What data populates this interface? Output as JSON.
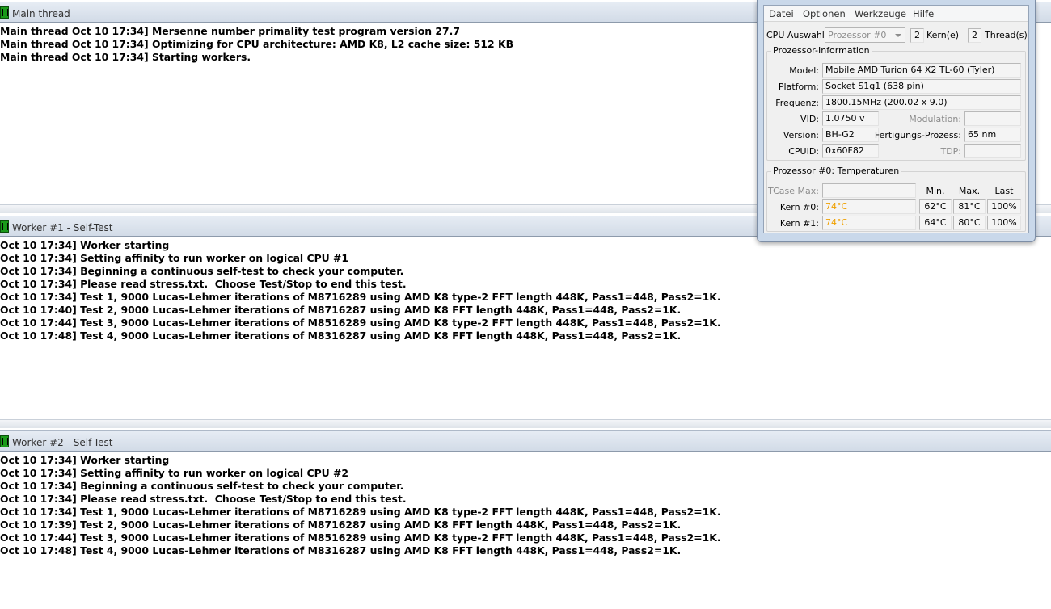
{
  "panes": [
    {
      "title": "Main thread",
      "lines": [
        "Main thread Oct 10 17:34] Mersenne number primality test program version 27.7",
        "Main thread Oct 10 17:34] Optimizing for CPU architecture: AMD K8, L2 cache size: 512 KB",
        "Main thread Oct 10 17:34] Starting workers."
      ]
    },
    {
      "title": "Worker #1 - Self-Test",
      "lines": [
        "Oct 10 17:34] Worker starting",
        "Oct 10 17:34] Setting affinity to run worker on logical CPU #1",
        "Oct 10 17:34] Beginning a continuous self-test to check your computer.",
        "Oct 10 17:34] Please read stress.txt.  Choose Test/Stop to end this test.",
        "Oct 10 17:34] Test 1, 9000 Lucas-Lehmer iterations of M8716289 using AMD K8 type-2 FFT length 448K, Pass1=448, Pass2=1K.",
        "Oct 10 17:40] Test 2, 9000 Lucas-Lehmer iterations of M8716287 using AMD K8 FFT length 448K, Pass1=448, Pass2=1K.",
        "Oct 10 17:44] Test 3, 9000 Lucas-Lehmer iterations of M8516289 using AMD K8 type-2 FFT length 448K, Pass1=448, Pass2=1K.",
        "Oct 10 17:48] Test 4, 9000 Lucas-Lehmer iterations of M8316287 using AMD K8 FFT length 448K, Pass1=448, Pass2=1K."
      ]
    },
    {
      "title": "Worker #2 - Self-Test",
      "lines": [
        "Oct 10 17:34] Worker starting",
        "Oct 10 17:34] Setting affinity to run worker on logical CPU #2",
        "Oct 10 17:34] Beginning a continuous self-test to check your computer.",
        "Oct 10 17:34] Please read stress.txt.  Choose Test/Stop to end this test.",
        "Oct 10 17:34] Test 1, 9000 Lucas-Lehmer iterations of M8716289 using AMD K8 type-2 FFT length 448K, Pass1=448, Pass2=1K.",
        "Oct 10 17:39] Test 2, 9000 Lucas-Lehmer iterations of M8716287 using AMD K8 FFT length 448K, Pass1=448, Pass2=1K.",
        "Oct 10 17:44] Test 3, 9000 Lucas-Lehmer iterations of M8516289 using AMD K8 type-2 FFT length 448K, Pass1=448, Pass2=1K.",
        "Oct 10 17:48] Test 4, 9000 Lucas-Lehmer iterations of M8316287 using AMD K8 FFT length 448K, Pass1=448, Pass2=1K."
      ]
    }
  ],
  "cpu_monitor": {
    "menu": [
      "Datei",
      "Optionen",
      "Werkzeuge",
      "Hilfe"
    ],
    "cpu_select_label": "CPU Auswahl:",
    "cpu_select_value": "Prozessor #0",
    "cores_value": "2",
    "cores_label": "Kern(e)",
    "threads_value": "2",
    "threads_label": "Thread(s)",
    "info_group_title": "Prozessor-Information",
    "model_label": "Model:",
    "model_value": "Mobile AMD Turion 64 X2 TL-60 (Tyler)",
    "platform_label": "Platform:",
    "platform_value": "Socket S1g1 (638 pin)",
    "frequency_label": "Frequenz:",
    "frequency_value": "1800.15MHz (200.02 x 9.0)",
    "vid_label": "VID:",
    "vid_value": "1.0750 v",
    "modulation_label": "Modulation:",
    "modulation_value": "",
    "version_label": "Version:",
    "version_value": "BH-G2",
    "process_label": "Fertigungs-Prozess:",
    "process_value": "65 nm",
    "cpuid_label": "CPUID:",
    "cpuid_value": "0x60F82",
    "tdp_label": "TDP:",
    "tdp_value": "",
    "temp_group_title": "Prozessor #0: Temperaturen",
    "tcase_label": "TCase Max:",
    "tcase_value": "",
    "col_min": "Min.",
    "col_max": "Max.",
    "col_last": "Last",
    "cores": [
      {
        "label": "Kern #0:",
        "temp": "74°C",
        "min": "62°C",
        "max": "81°C",
        "load": "100%"
      },
      {
        "label": "Kern #1:",
        "temp": "74°C",
        "min": "64°C",
        "max": "80°C",
        "load": "100%"
      }
    ],
    "hot_color": "#f0a000"
  }
}
